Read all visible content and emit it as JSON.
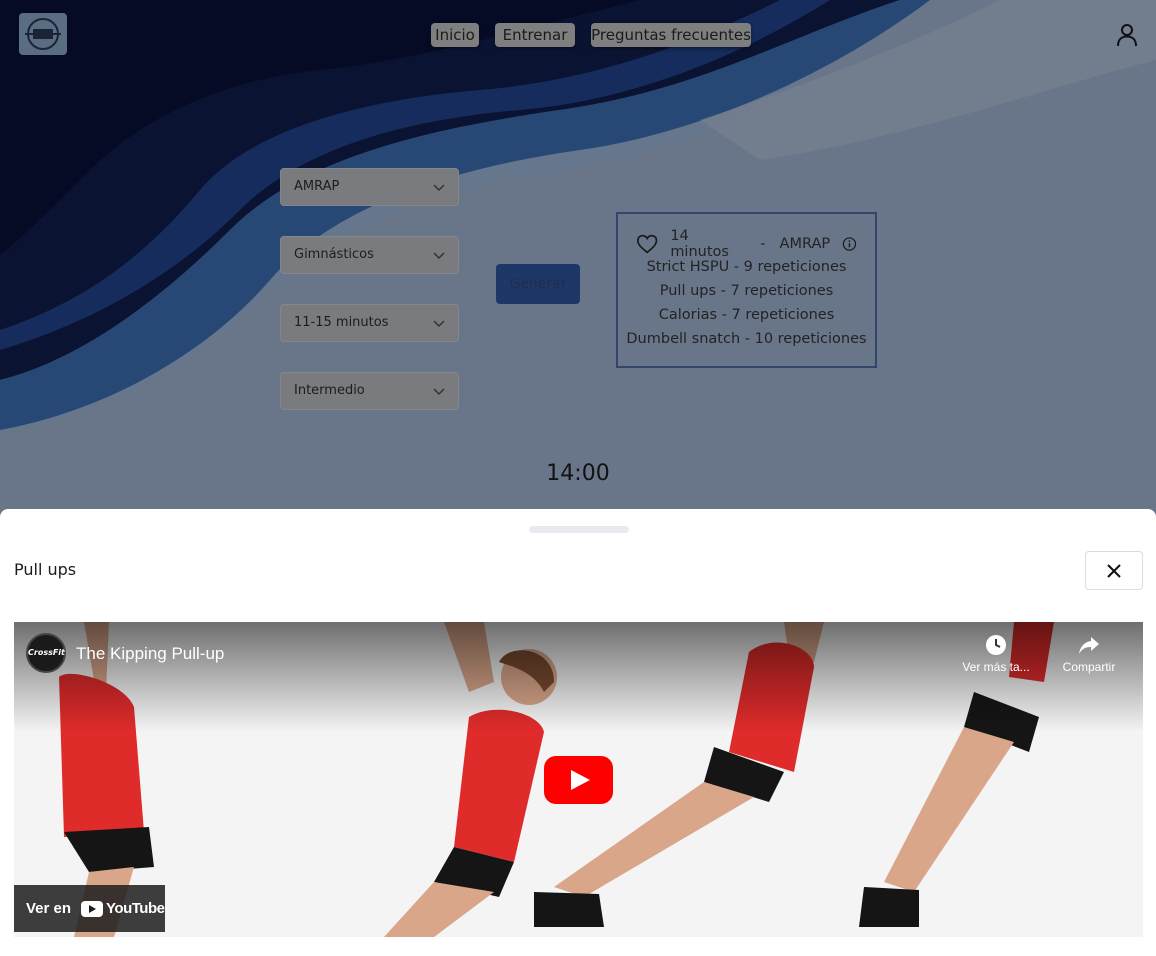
{
  "header": {
    "nav": [
      {
        "label": "Inicio"
      },
      {
        "label": "Entrenar"
      },
      {
        "label": "Preguntas frecuentes"
      }
    ]
  },
  "form": {
    "selects": [
      {
        "value": "AMRAP"
      },
      {
        "value": "Gimnásticos"
      },
      {
        "value": "11-15 minutos"
      },
      {
        "value": "Intermedio"
      }
    ],
    "generate_label": "Generar"
  },
  "workout": {
    "duration": "14 minutos",
    "separator": "-",
    "type": "AMRAP",
    "exercises": [
      "Strict HSPU - 9 repeticiones",
      "Pull ups - 7 repeticiones",
      "Calorias - 7 repeticiones",
      "Dumbell snatch - 10 repeticiones"
    ]
  },
  "timer": "14:00",
  "sheet": {
    "title": "Pull ups",
    "video": {
      "channel": "CrossFit",
      "title": "The Kipping Pull-up",
      "watch_later": "Ver más ta...",
      "share": "Compartir",
      "watch_on": "Ver en",
      "yt_word": "YouTube"
    }
  },
  "colors": {
    "accent": "#1d3766",
    "youtube_red": "#ff0000",
    "shirt_red": "#e02b2b"
  }
}
